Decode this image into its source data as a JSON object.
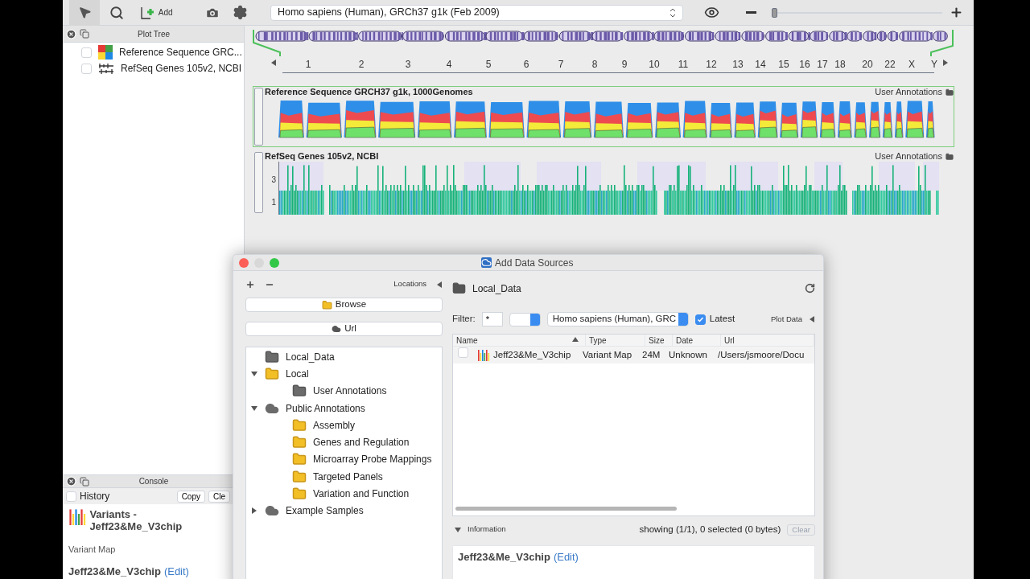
{
  "toolbar": {
    "add_label": "Add",
    "genome": "Homo sapiens (Human), GRCh37 g1k (Feb 2009)",
    "zoom": {
      "level": 0.0
    }
  },
  "plot_tree": {
    "title": "Plot Tree",
    "items": [
      {
        "label": "Reference Sequence GRC...",
        "checked": false,
        "kind": "sequence"
      },
      {
        "label": "RefSeq Genes 105v2, NCBI",
        "checked": false,
        "kind": "genes"
      }
    ]
  },
  "ruler": {
    "labels": [
      "1",
      "2",
      "3",
      "4",
      "5",
      "6",
      "7",
      "8",
      "9",
      "10",
      "11",
      "12",
      "13",
      "14",
      "15",
      "16",
      "17",
      "18",
      "20",
      "22",
      "X",
      "Y"
    ]
  },
  "tracks": [
    {
      "title": "Reference Sequence GRCH37 g1k, 1000Genomes",
      "source": "User Annotations",
      "kind": "coverage",
      "selected": true
    },
    {
      "title": "RefSeq Genes 105v2, NCBI",
      "source": "User Annotations",
      "kind": "genes",
      "selected": false,
      "ticks": [
        "3",
        "1"
      ]
    }
  ],
  "console": {
    "title": "Console",
    "history": {
      "label": "History",
      "checked": false
    },
    "buttons": [
      "Copy",
      "Cle"
    ],
    "entry_title": "Variants - Jeff23&Me_V3chip",
    "entry_type": "Variant Map",
    "entry_name": "Jeff23&Me_V3chip",
    "edit_link": "(Edit)"
  },
  "dialog": {
    "title": "Add Data Sources",
    "locations_label": "Locations",
    "browse": "Browse",
    "url": "Url",
    "tree": [
      {
        "label": "Local_Data",
        "kind": "drive",
        "selected": false
      },
      {
        "label": "Local",
        "kind": "folder",
        "expanded": true,
        "selected": false,
        "children": [
          {
            "label": "User Annotations",
            "kind": "drive",
            "selected": false
          }
        ]
      },
      {
        "label": "Public Annotations",
        "kind": "cloud",
        "expanded": true,
        "selected": false,
        "children": [
          {
            "label": "Assembly",
            "kind": "folder",
            "selected": false
          },
          {
            "label": "Genes and Regulation",
            "kind": "folder",
            "selected": false
          },
          {
            "label": "Microarray Probe Mappings",
            "kind": "folder",
            "selected": false
          },
          {
            "label": "Targeted Panels",
            "kind": "folder",
            "selected": false
          },
          {
            "label": "Variation and Function",
            "kind": "folder",
            "selected": false
          }
        ]
      },
      {
        "label": "Example Samples",
        "kind": "cloud",
        "expanded": false,
        "selected": false
      }
    ],
    "path": "Local_Data",
    "filter_label": "Filter:",
    "filter_value": "*",
    "genome": "Homo sapiens (Human), GRC",
    "latest": {
      "label": "Latest",
      "checked": true
    },
    "plot_data": "Plot Data",
    "columns": [
      "Name",
      "Type",
      "Size",
      "Date",
      "Url"
    ],
    "rows": [
      {
        "checked": false,
        "cells": [
          "Jeff23&Me_V3chip",
          "Variant Map",
          "24M",
          "Unknown",
          "/Users/jsmoore/Docu"
        ]
      }
    ],
    "info": {
      "label": "Information",
      "expanded": true,
      "status": "showing (1/1), 0 selected (0 bytes)",
      "clear": "Clear",
      "name": "Jeff23&Me_V3chip",
      "edit_link": "(Edit)"
    }
  }
}
